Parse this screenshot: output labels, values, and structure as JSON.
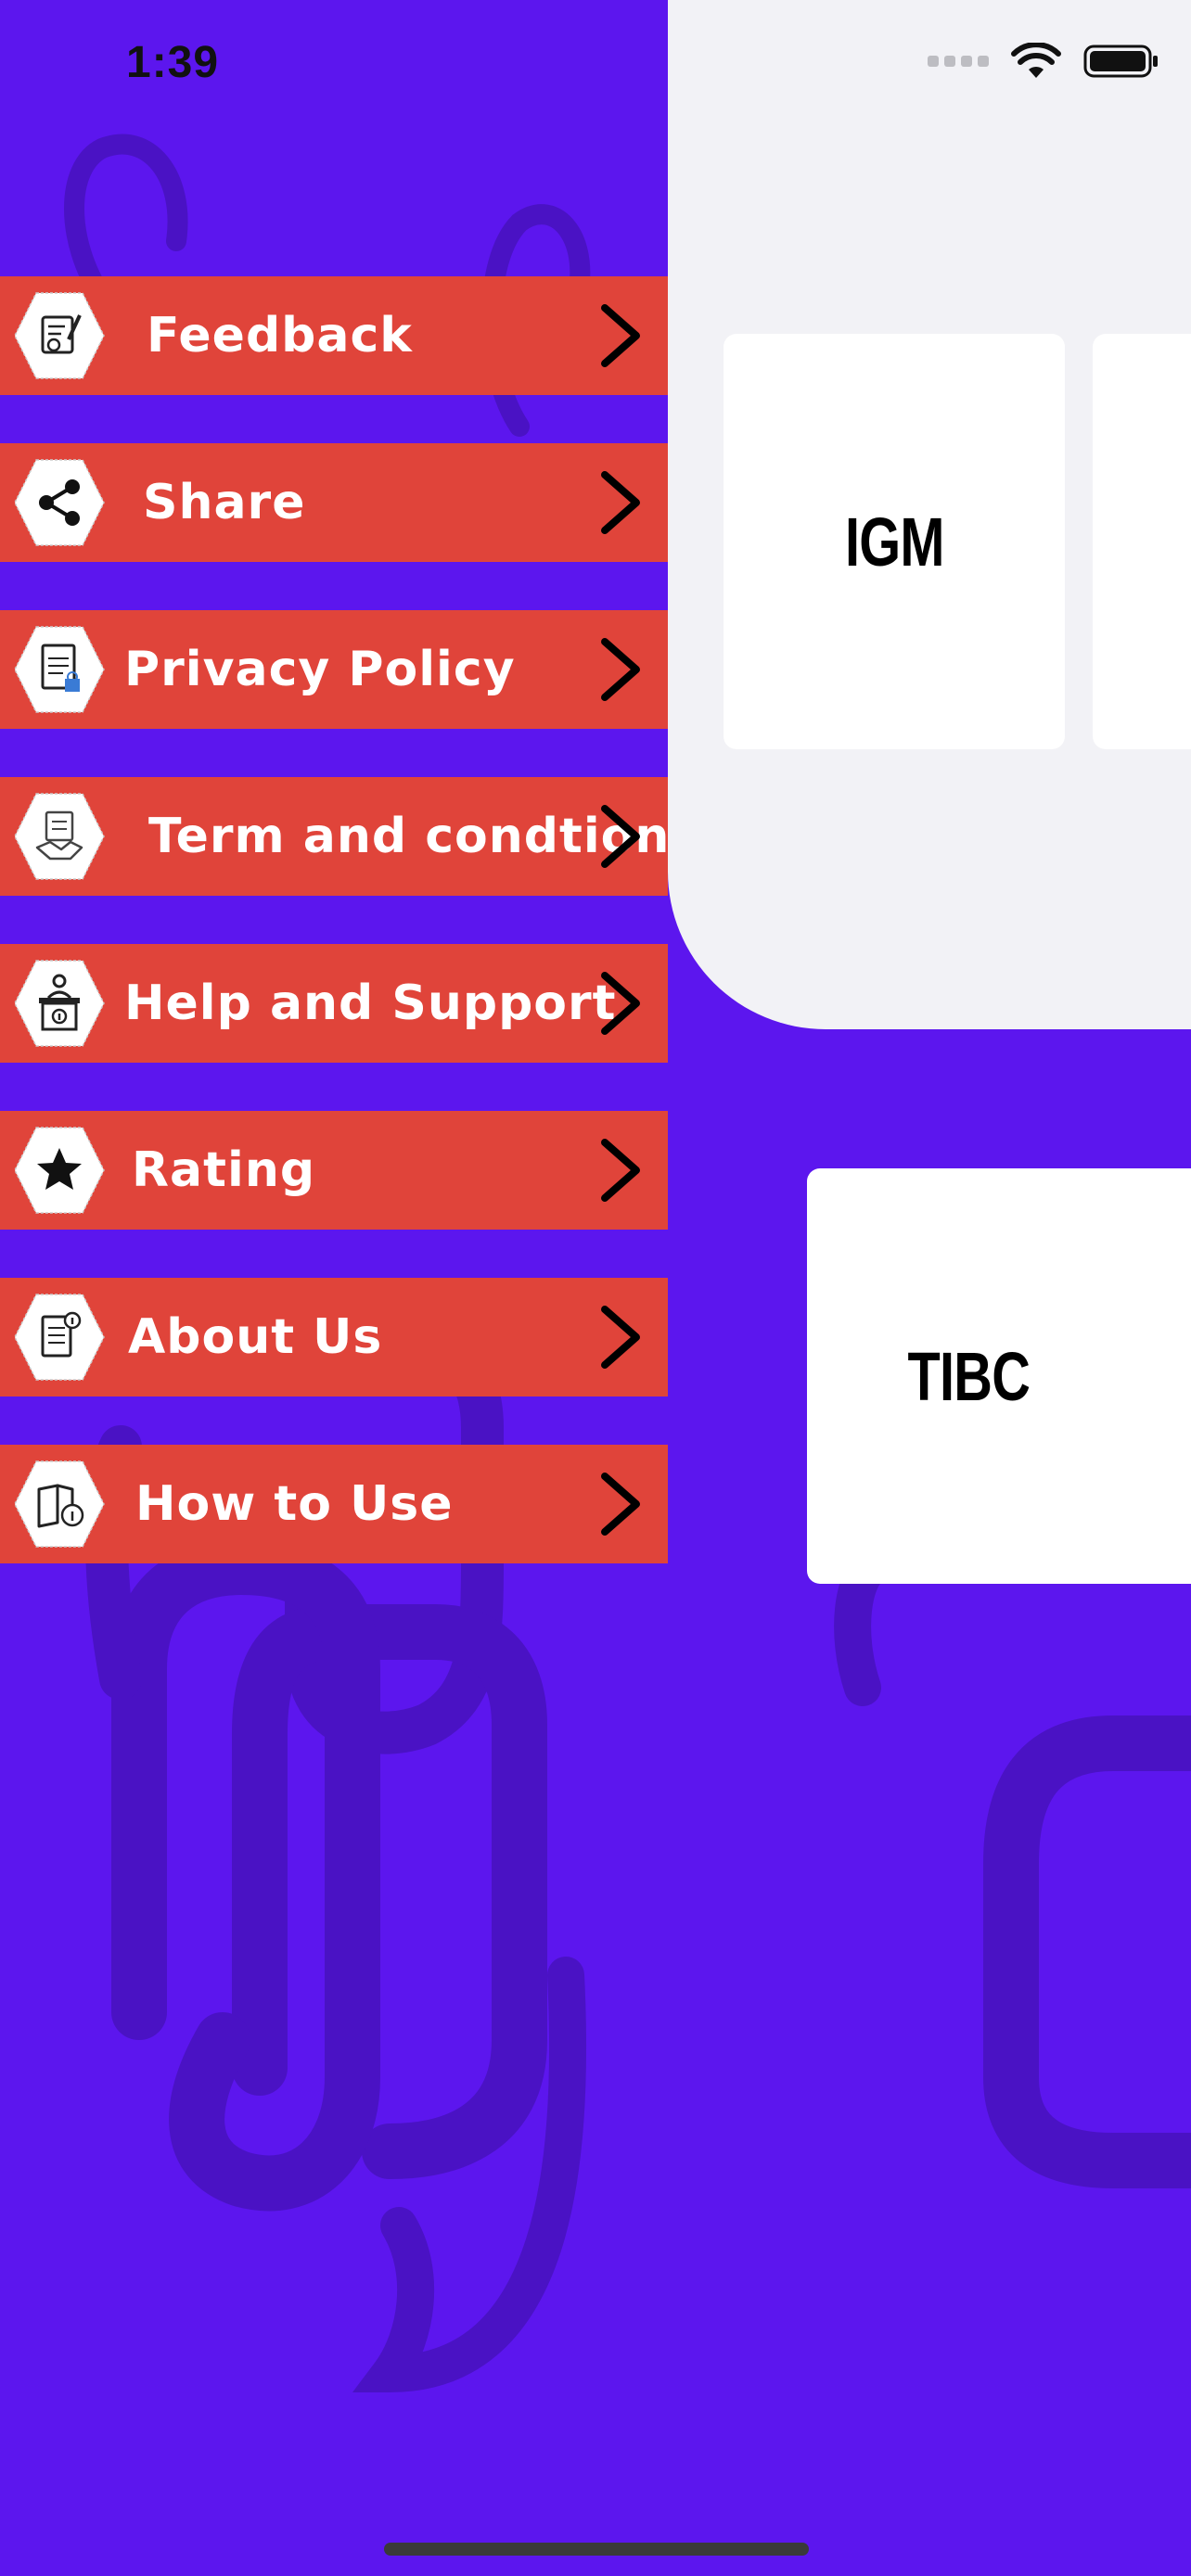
{
  "status_bar": {
    "time": "1:39"
  },
  "colors": {
    "background": "#5C16EE",
    "panel": "#F2F2F6",
    "menu_item": "#E0443A",
    "card": "#FFFFFF"
  },
  "menu": {
    "items": [
      {
        "label": "Feedback",
        "icon": "feedback-icon"
      },
      {
        "label": "Share",
        "icon": "share-icon"
      },
      {
        "label": "Privacy Policy",
        "icon": "privacy-policy-icon"
      },
      {
        "label": "Term and condtion",
        "icon": "handshake-icon"
      },
      {
        "label": "Help and Support",
        "icon": "help-desk-icon"
      },
      {
        "label": "Rating",
        "icon": "star-icon"
      },
      {
        "label": "About Us",
        "icon": "about-document-icon"
      },
      {
        "label": "How to Use",
        "icon": "guide-book-icon"
      }
    ]
  },
  "cards": {
    "igm": "IGM",
    "tibc": "TIBC"
  }
}
